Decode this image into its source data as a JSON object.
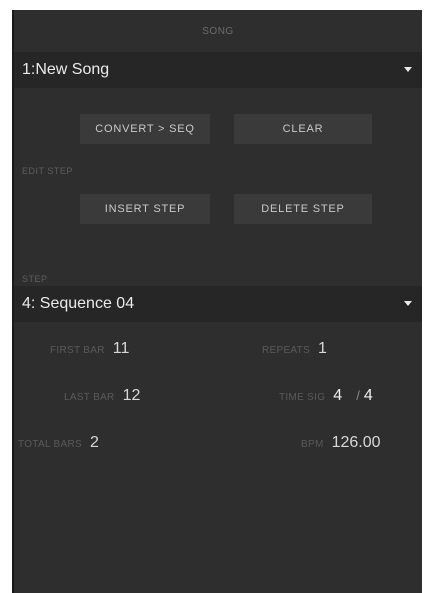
{
  "song_section": {
    "header": "SONG",
    "selected_song": "1:New Song",
    "convert_button": "CONVERT > SEQ",
    "clear_button": "CLEAR"
  },
  "edit_step": {
    "header": "EDIT STEP",
    "insert_button": "INSERT STEP",
    "delete_button": "DELETE STEP"
  },
  "step_section": {
    "header": "STEP",
    "selected_step": "4: Sequence 04"
  },
  "fields": {
    "first_bar": {
      "label": "FIRST BAR",
      "value": "11"
    },
    "repeats": {
      "label": "REPEATS",
      "value": "1"
    },
    "last_bar": {
      "label": "LAST BAR",
      "value": "12"
    },
    "time_sig": {
      "label": "TIME SIG",
      "numerator": "4",
      "separator": "/",
      "denominator": "4"
    },
    "total_bars": {
      "label": "TOTAL BARS",
      "value": "2"
    },
    "bpm": {
      "label": "BPM",
      "value": "126.00"
    }
  }
}
